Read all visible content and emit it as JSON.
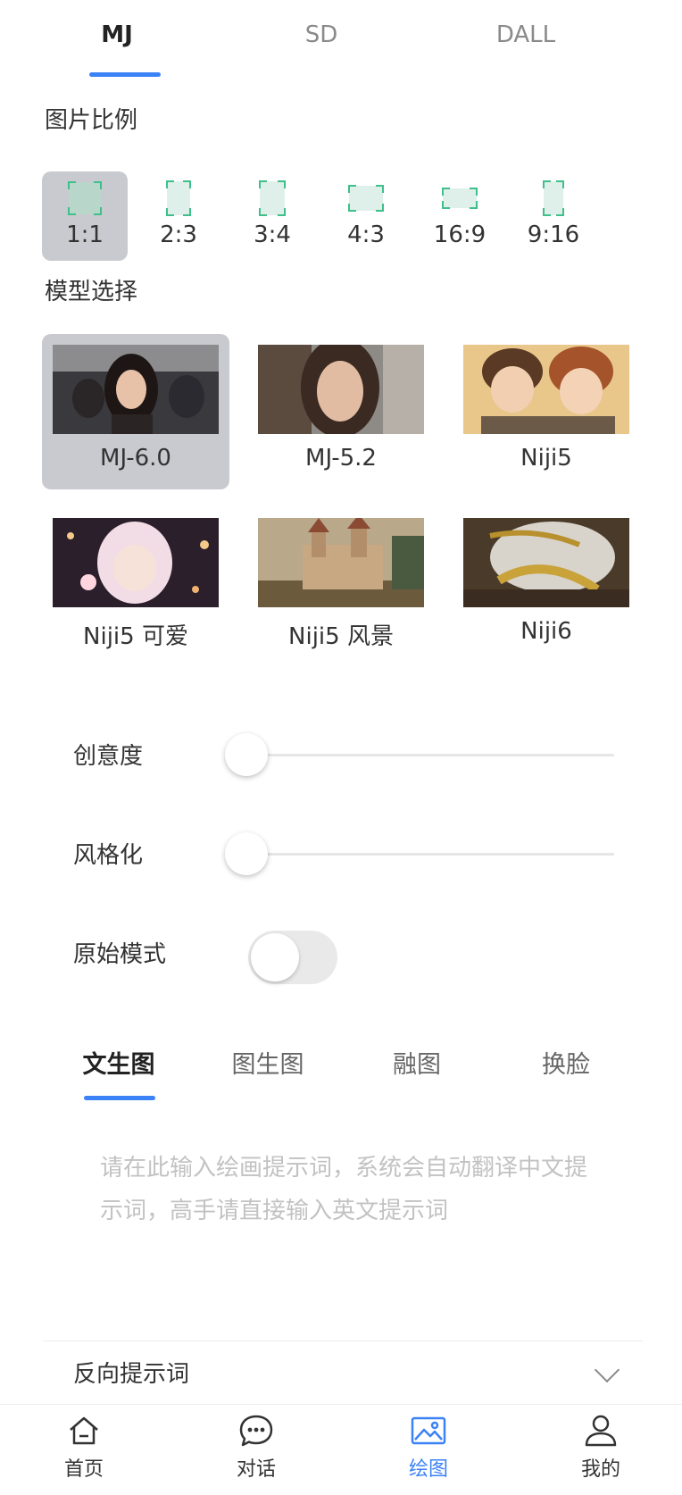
{
  "top_tabs": [
    "MJ",
    "SD",
    "DALL"
  ],
  "aspect_section": {
    "title": "图片比例",
    "options": [
      "1:1",
      "2:3",
      "3:4",
      "4:3",
      "16:9",
      "9:16"
    ],
    "selected": "1:1"
  },
  "model_section": {
    "title": "模型选择",
    "models": [
      "MJ-6.0",
      "MJ-5.2",
      "Niji5",
      "Niji5 可爱",
      "Niji5 风景",
      "Niji6"
    ],
    "selected": "MJ-6.0"
  },
  "settings": {
    "creativity": {
      "label": "创意度",
      "value": 0
    },
    "stylize": {
      "label": "风格化",
      "value": 0
    },
    "raw_mode": {
      "label": "原始模式",
      "on": false
    }
  },
  "mode_tabs": [
    "文生图",
    "图生图",
    "融图",
    "换脸"
  ],
  "prompt": {
    "placeholder": "请在此输入绘画提示词，系统会自动翻译中文提示词，高手请直接输入英文提示词",
    "value": ""
  },
  "negative_prompt": {
    "label": "反向提示词"
  },
  "bottom_nav": [
    "首页",
    "对话",
    "绘图",
    "我的"
  ],
  "colors": {
    "accent": "#3b82f6",
    "selected_bg": "#c8cacf",
    "ratio_corner": "#3fbf8a"
  }
}
